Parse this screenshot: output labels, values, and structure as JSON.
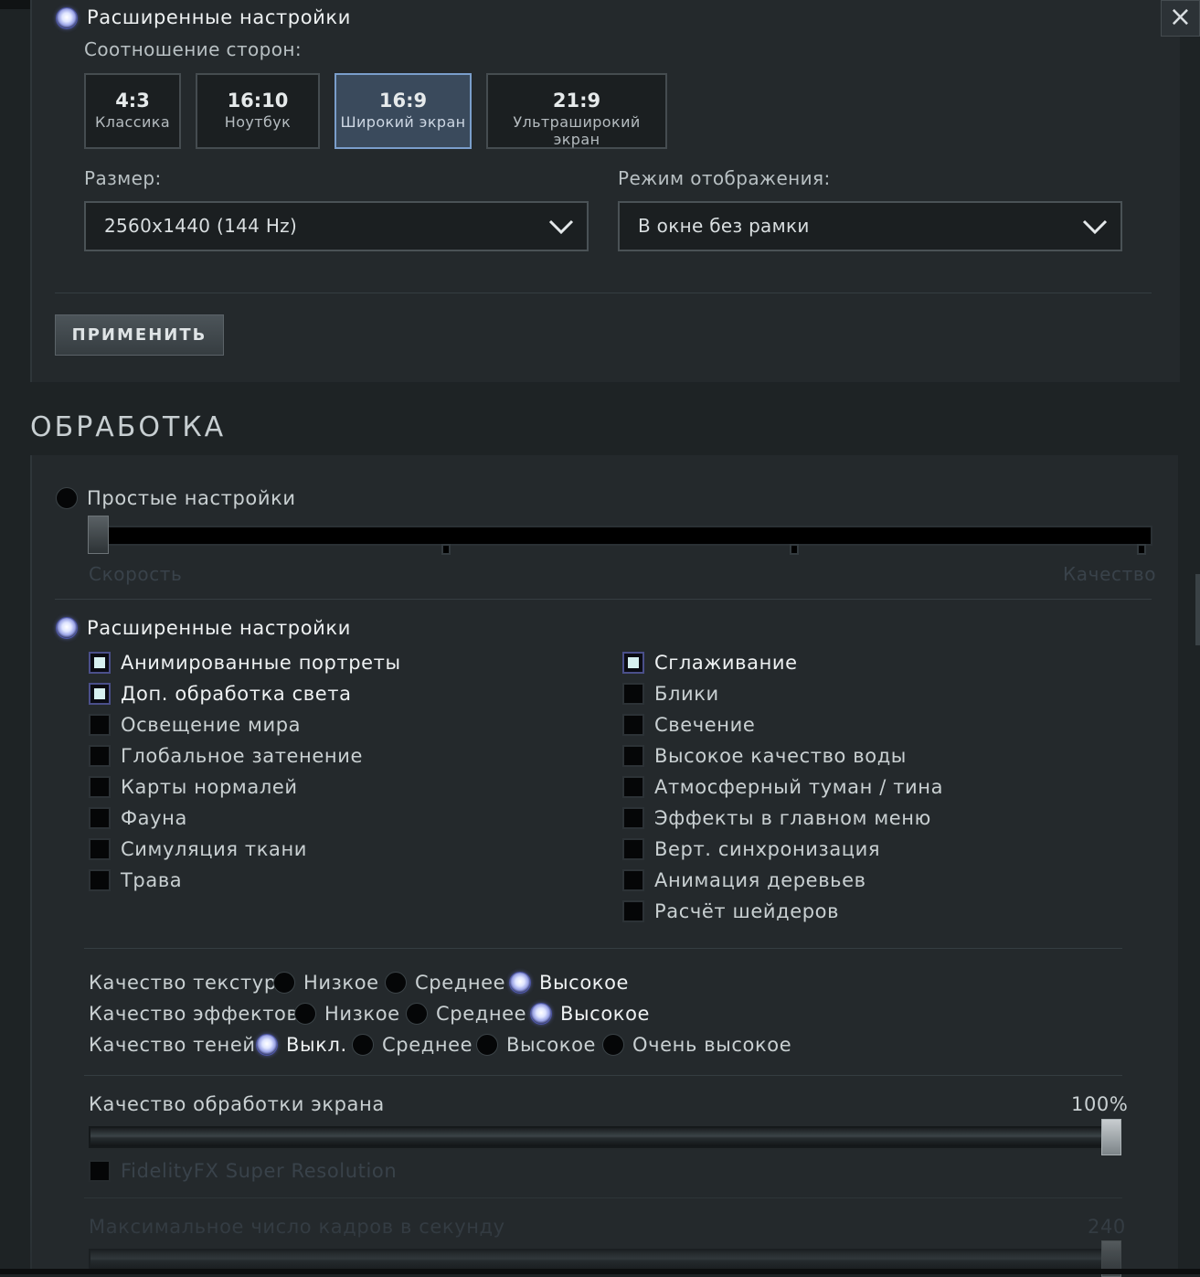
{
  "close_label": "×",
  "display": {
    "advanced_label": "Расширенные настройки",
    "aspect_label": "Соотношение сторон:",
    "aspects": [
      {
        "ratio": "4:3",
        "name": "Классика"
      },
      {
        "ratio": "16:10",
        "name": "Ноутбук"
      },
      {
        "ratio": "16:9",
        "name": "Широкий экран"
      },
      {
        "ratio": "21:9",
        "name": "Ультраширокий экран"
      }
    ],
    "selected_aspect": "16:9",
    "size_label": "Размер:",
    "size_value": "2560x1440 (144 Hz)",
    "mode_label": "Режим отображения:",
    "mode_value": "В окне без рамки",
    "apply_label": "ПРИМЕНИТЬ"
  },
  "rendering": {
    "title": "ОБРАБОТКА",
    "simple_label": "Простые настройки",
    "slider_min_label": "Скорость",
    "slider_max_label": "Качество",
    "advanced_label": "Расширенные настройки",
    "left_options": [
      {
        "label": "Анимированные портреты",
        "checked": true
      },
      {
        "label": "Доп. обработка света",
        "checked": true
      },
      {
        "label": "Освещение мира",
        "checked": false
      },
      {
        "label": "Глобальное затенение",
        "checked": false
      },
      {
        "label": "Карты нормалей",
        "checked": false
      },
      {
        "label": "Фауна",
        "checked": false
      },
      {
        "label": "Симуляция ткани",
        "checked": false
      },
      {
        "label": "Трава",
        "checked": false
      }
    ],
    "right_options": [
      {
        "label": "Сглаживание",
        "checked": true
      },
      {
        "label": "Блики",
        "checked": false
      },
      {
        "label": "Свечение",
        "checked": false
      },
      {
        "label": "Высокое качество воды",
        "checked": false
      },
      {
        "label": "Атмосферный туман / тина",
        "checked": false
      },
      {
        "label": "Эффекты в главном меню",
        "checked": false
      },
      {
        "label": "Верт. синхронизация",
        "checked": false
      },
      {
        "label": "Анимация деревьев",
        "checked": false
      },
      {
        "label": "Расчёт шейдеров",
        "checked": false
      }
    ],
    "texture_label": "Качество текстур",
    "texture_options": [
      "Низкое",
      "Среднее",
      "Высокое"
    ],
    "texture_selected": "Высокое",
    "effects_label": "Качество эффектов",
    "effects_options": [
      "Низкое",
      "Среднее",
      "Высокое"
    ],
    "effects_selected": "Высокое",
    "shadow_label": "Качество теней",
    "shadow_options": [
      "Выкл.",
      "Среднее",
      "Высокое",
      "Очень высокое"
    ],
    "shadow_selected": "Выкл.",
    "screen_quality_label": "Качество обработки экрана",
    "screen_quality_value": "100%",
    "screen_quality_fraction": 1.0,
    "fsr_label": "FidelityFX Super Resolution",
    "fsr_checked": false,
    "fps_label": "Максимальное число кадров в секунду",
    "fps_value": "240",
    "fps_fraction": 1.0
  },
  "colors": {
    "accent_selected": "#7a9ecb",
    "background": "#1e2325",
    "panel": "#24292c"
  }
}
